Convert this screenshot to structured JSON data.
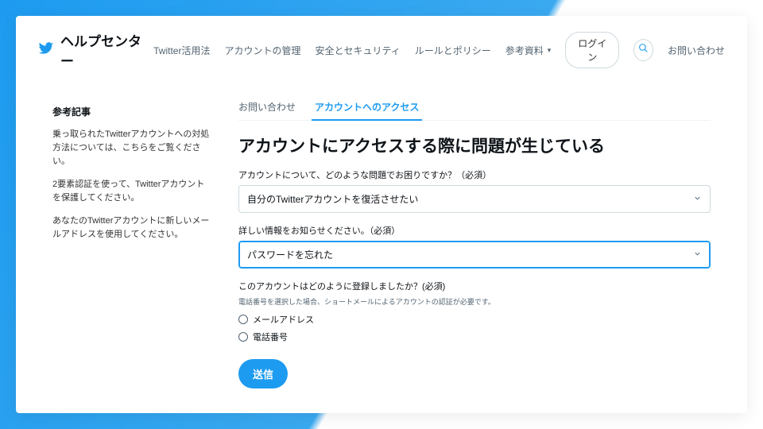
{
  "header": {
    "site_title": "ヘルプセンター",
    "nav": {
      "usage": "Twitter活用法",
      "manage": "アカウントの管理",
      "safety": "安全とセキュリティ",
      "rules": "ルールとポリシー",
      "resources": "参考資料"
    },
    "login": "ログイン",
    "contact": "お問い合わせ"
  },
  "sidebar": {
    "heading": "参考記事",
    "items": [
      "乗っ取られたTwitterアカウントへの対処方法については、こちらをご覧ください。",
      "2要素認証を使って、Twitterアカウントを保護してください。",
      "あなたのTwitterアカウントに新しいメールアドレスを使用してください。"
    ]
  },
  "tabs": {
    "contact": "お問い合わせ",
    "access": "アカウントへのアクセス"
  },
  "page_title": "アカウントにアクセスする際に問題が生じている",
  "form": {
    "q1_label": "アカウントについて、どのような問題でお困りですか？（必須）",
    "q1_value": "自分のTwitterアカウントを復活させたい",
    "q2_label": "詳しい情報をお知らせください。（必須）",
    "q2_value": "パスワードを忘れた",
    "q3_label": "このアカウントはどのように登録しましたか？(必須)",
    "q3_hint": "電話番号を選択した場合、ショートメールによるアカウントの認証が必要です。",
    "radio_email": "メールアドレス",
    "radio_phone": "電話番号",
    "submit": "送信"
  }
}
